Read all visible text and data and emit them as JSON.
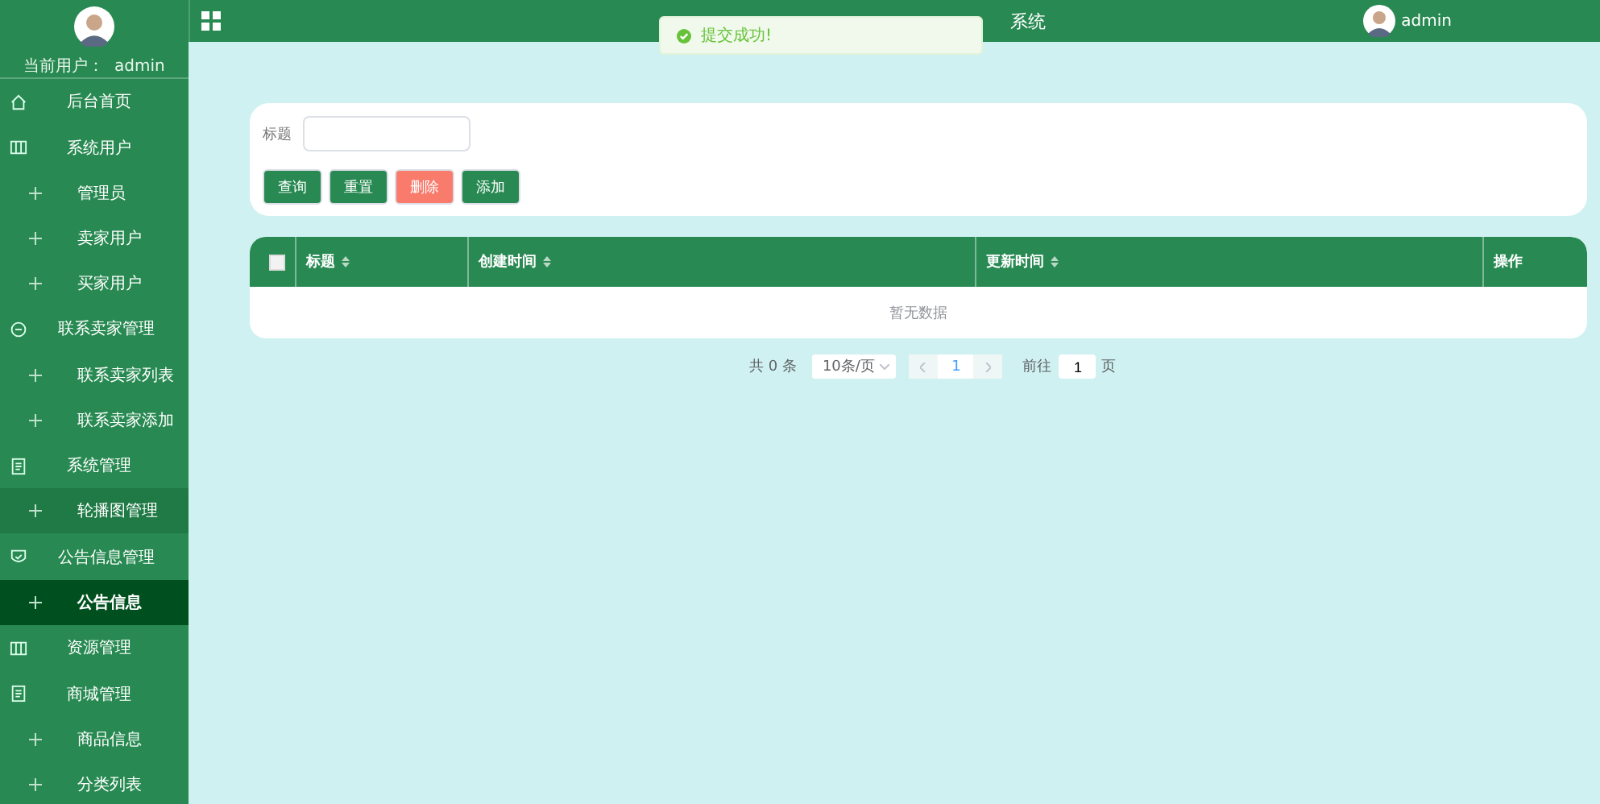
{
  "sidebar": {
    "user_label": "当前用户：  admin",
    "menu": [
      {
        "label": "后台首页"
      },
      {
        "label": "系统用户",
        "children": [
          {
            "label": "管理员",
            "selected": false,
            "hovered": false
          },
          {
            "label": "卖家用户",
            "selected": false,
            "hovered": false
          },
          {
            "label": "买家用户",
            "selected": false,
            "hovered": false
          }
        ]
      },
      {
        "label": "联系卖家管理",
        "children": [
          {
            "label": "联系卖家列表",
            "selected": false,
            "hovered": false
          },
          {
            "label": "联系卖家添加",
            "selected": false,
            "hovered": false
          }
        ]
      },
      {
        "label": "系统管理",
        "children": [
          {
            "label": "轮播图管理",
            "selected": false,
            "hovered": true
          }
        ]
      },
      {
        "label": "公告信息管理",
        "children": [
          {
            "label": "公告信息",
            "selected": true,
            "hovered": false
          }
        ]
      },
      {
        "label": "资源管理"
      },
      {
        "label": "商城管理",
        "children": [
          {
            "label": "商品信息",
            "selected": false,
            "hovered": false
          },
          {
            "label": "分类列表",
            "selected": false,
            "hovered": false
          }
        ]
      }
    ]
  },
  "header": {
    "title": "系统",
    "username": "admin"
  },
  "toast": {
    "message": "提交成功!"
  },
  "search": {
    "label": "标题",
    "buttons": [
      {
        "label": "查询",
        "kind": "primary"
      },
      {
        "label": "重置",
        "kind": "primary"
      },
      {
        "label": "删除",
        "kind": "danger"
      },
      {
        "label": "添加",
        "kind": "primary"
      }
    ]
  },
  "table": {
    "select_all": {
      "checked": false
    },
    "columns": [
      {
        "label": "标题",
        "sortable": true
      },
      {
        "label": "创建时间",
        "sortable": true
      },
      {
        "label": "更新时间",
        "sortable": true
      },
      {
        "label": "操作",
        "sortable": false
      }
    ],
    "empty_text": "暂无数据"
  },
  "pagination": {
    "total": "共 0 条",
    "page_size": "10条/页",
    "pages": [
      {
        "label": "1",
        "selected": true
      }
    ],
    "goto_label": "前往",
    "goto_value": "1",
    "page_suffix": "页"
  }
}
